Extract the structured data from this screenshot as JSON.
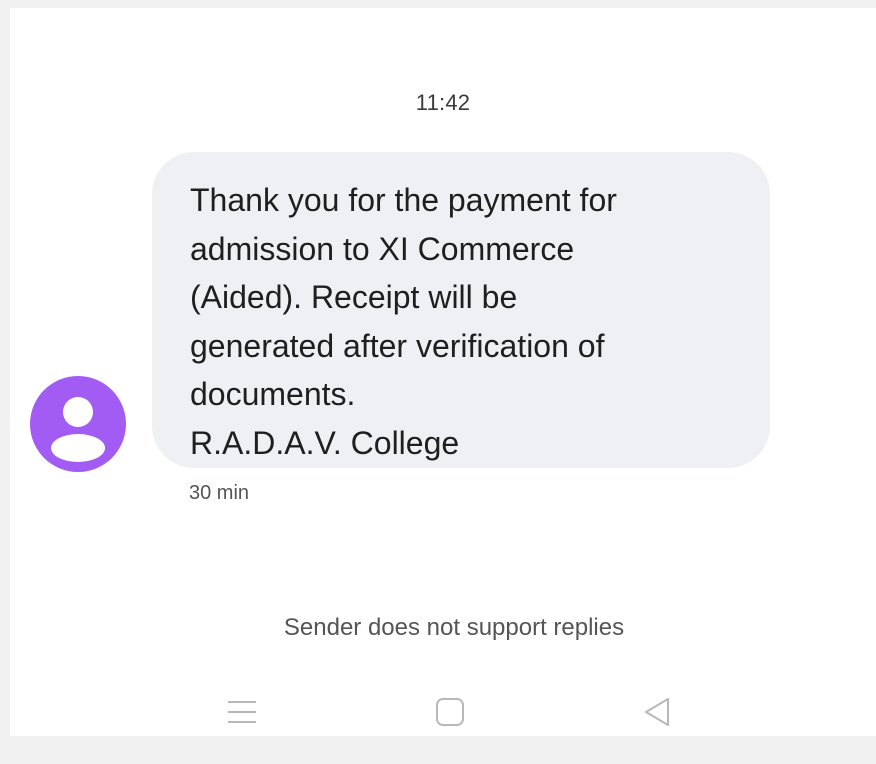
{
  "conversation": {
    "timestamp": "11:42",
    "message": {
      "text": "Thank you for the payment for\nadmission to XI Commerce\n(Aided). Receipt will be\ngenerated after verification of\ndocuments.\nR.A.D.A.V.  College",
      "time_ago": "30 min"
    },
    "avatar_color": "#a25cf3",
    "bubble_color": "#eff0f3"
  },
  "footer": {
    "notice": "Sender does not support replies"
  },
  "navigation": {
    "icons": [
      "menu-icon",
      "home-icon",
      "back-icon"
    ]
  }
}
